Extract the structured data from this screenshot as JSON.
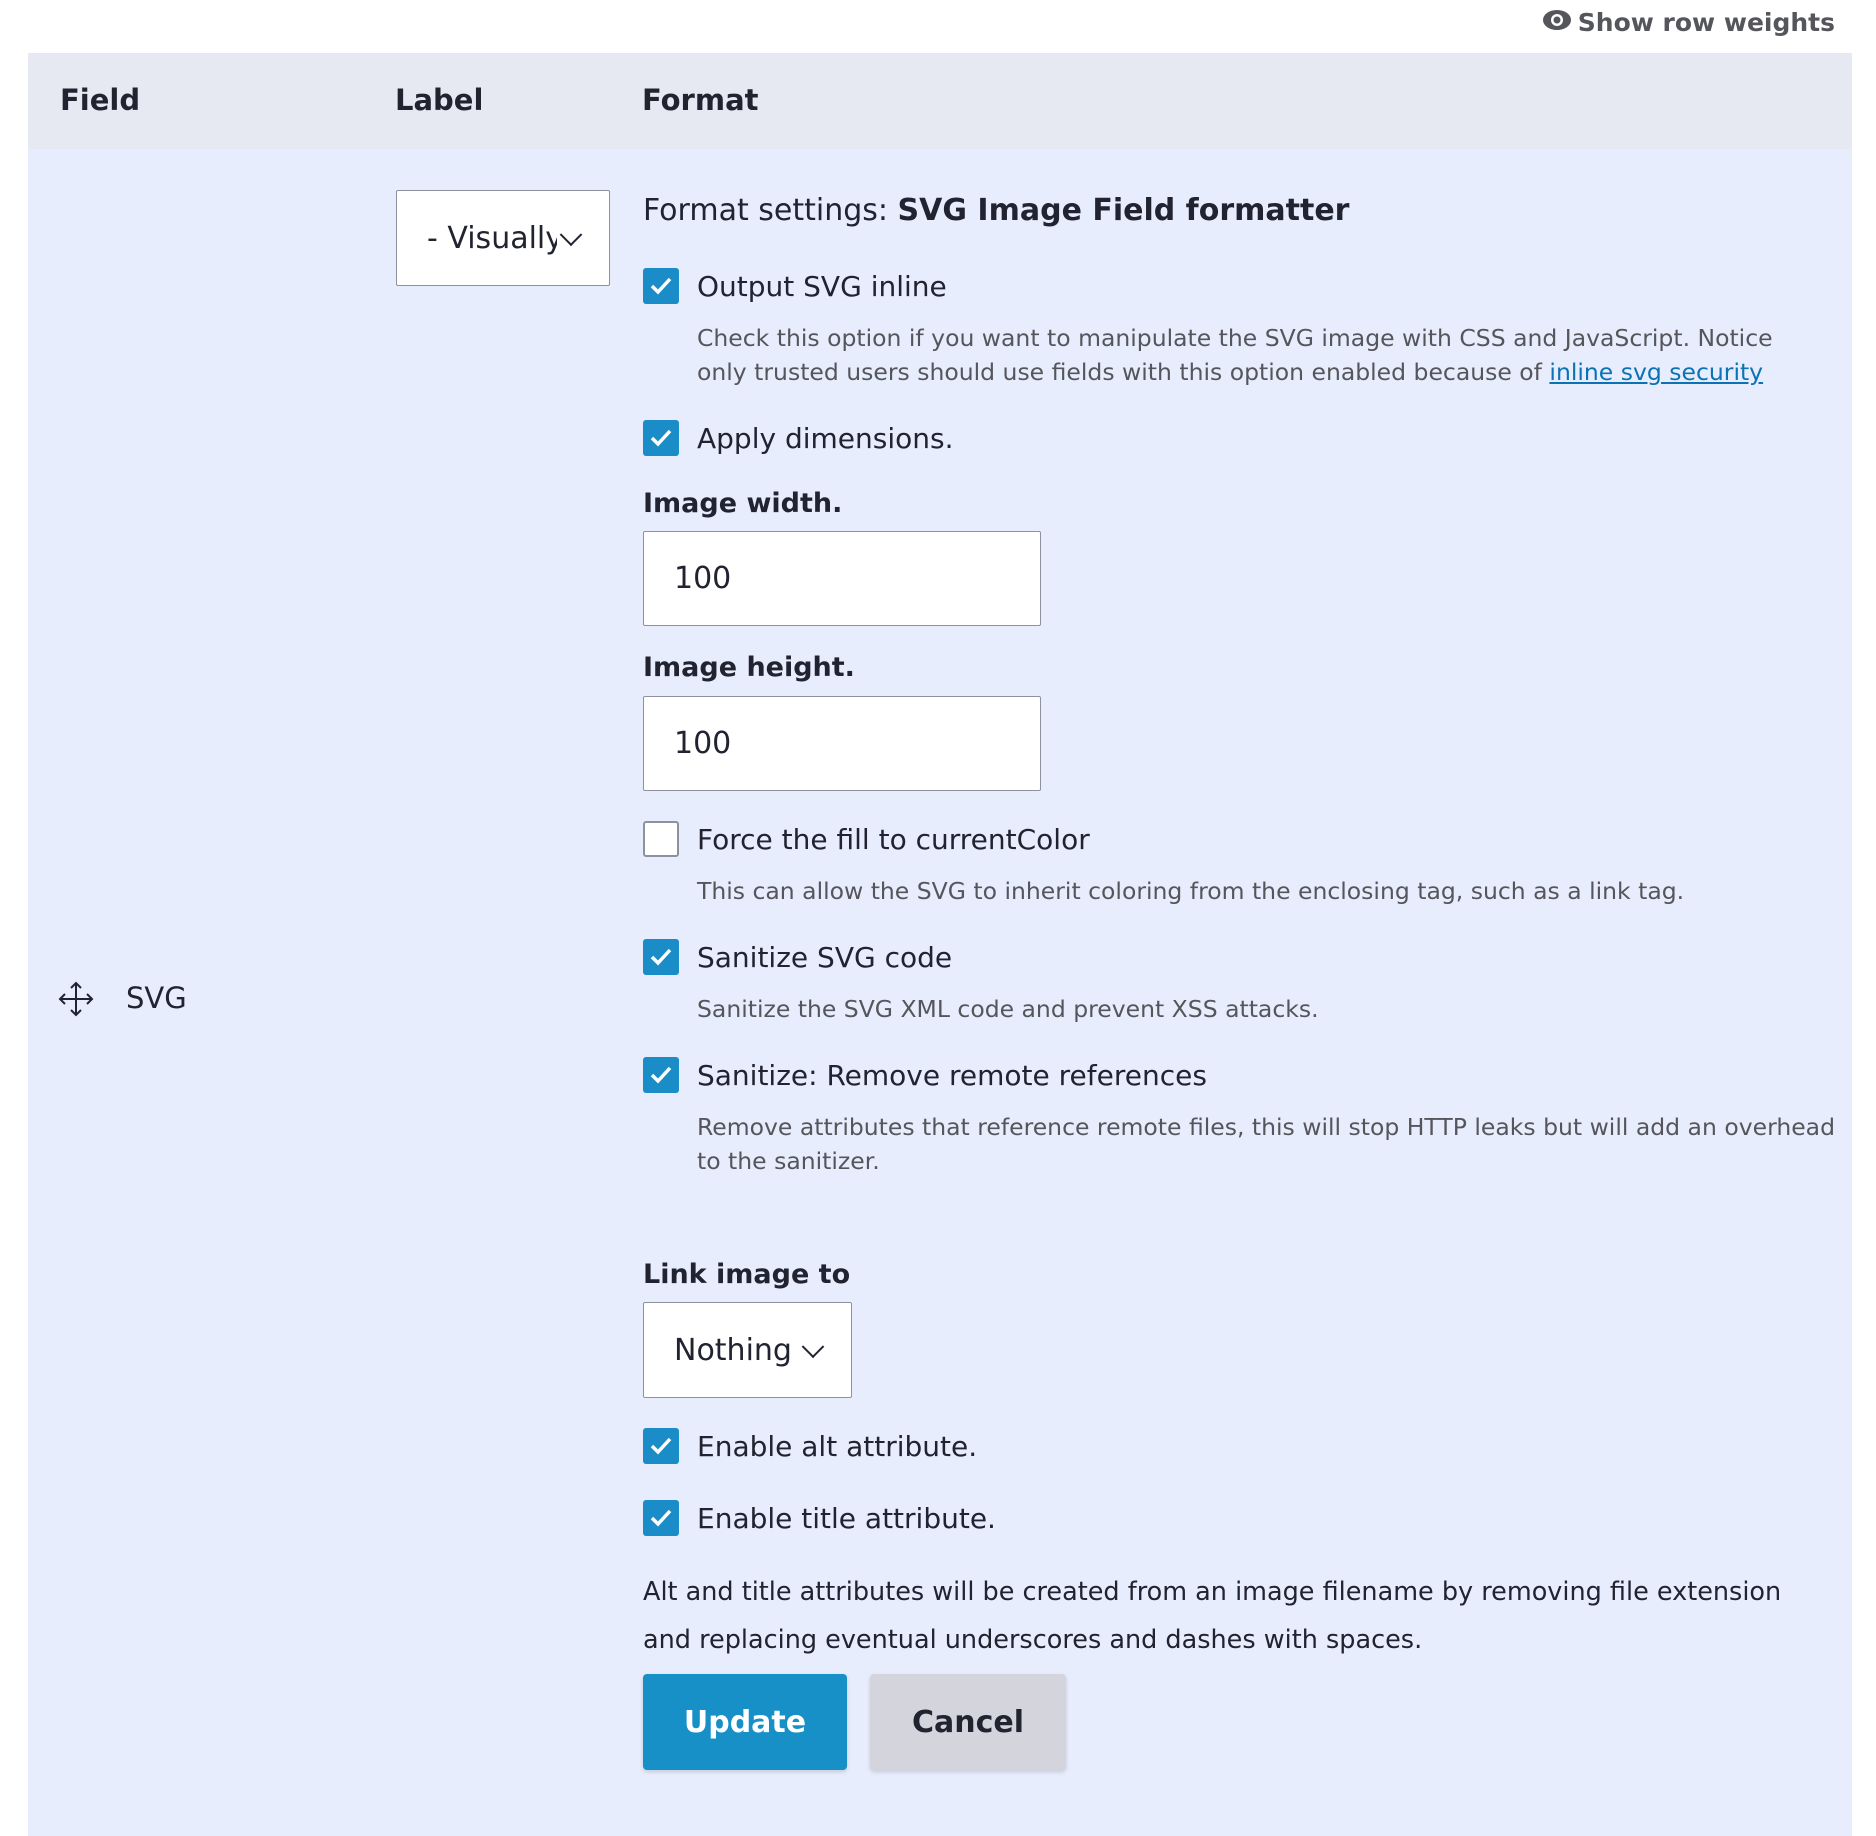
{
  "toolbar": {
    "show_row_weights": "Show row weights"
  },
  "table": {
    "headers": {
      "field": "Field",
      "label": "Label",
      "format": "Format"
    }
  },
  "row": {
    "field_name": "SVG",
    "label_select": "- Visually Hidden -"
  },
  "format": {
    "title_prefix": "Format settings: ",
    "title_bold": "SVG Image Field formatter",
    "output_inline": {
      "label": "Output SVG inline",
      "checked": true,
      "desc": "Check this option if you want to manipulate the SVG image with CSS and JavaScript. Notice only trusted users should use fields with this option enabled because of ",
      "link": "inline svg security"
    },
    "apply_dimensions": {
      "label": "Apply dimensions.",
      "checked": true
    },
    "image_width": {
      "label": "Image width.",
      "value": "100"
    },
    "image_height": {
      "label": "Image height.",
      "value": "100"
    },
    "force_fill": {
      "label": "Force the fill to currentColor",
      "checked": false,
      "desc": "This can allow the SVG to inherit coloring from the enclosing tag, such as a link tag."
    },
    "sanitize": {
      "label": "Sanitize SVG code",
      "checked": true,
      "desc": "Sanitize the SVG XML code and prevent XSS attacks."
    },
    "remove_remote": {
      "label": "Sanitize: Remove remote references",
      "checked": true,
      "desc": "Remove attributes that reference remote files, this will stop HTTP leaks but will add an overhead to the sanitizer."
    },
    "link_image": {
      "label": "Link image to",
      "value": "Nothing"
    },
    "enable_alt": {
      "label": "Enable alt attribute.",
      "checked": true
    },
    "enable_title": {
      "label": "Enable title attribute.",
      "checked": true
    },
    "note": "Alt and title attributes will be created from an image filename by removing file extension and replacing eventual underscores and dashes with spaces.",
    "update": "Update",
    "cancel": "Cancel"
  },
  "colors": {
    "accent": "#1a8dc8",
    "button": "#1690c7",
    "cancel_bg": "#d3d4dc",
    "row_bg": "#e7edfd",
    "header_bg": "#e6e9f2"
  }
}
